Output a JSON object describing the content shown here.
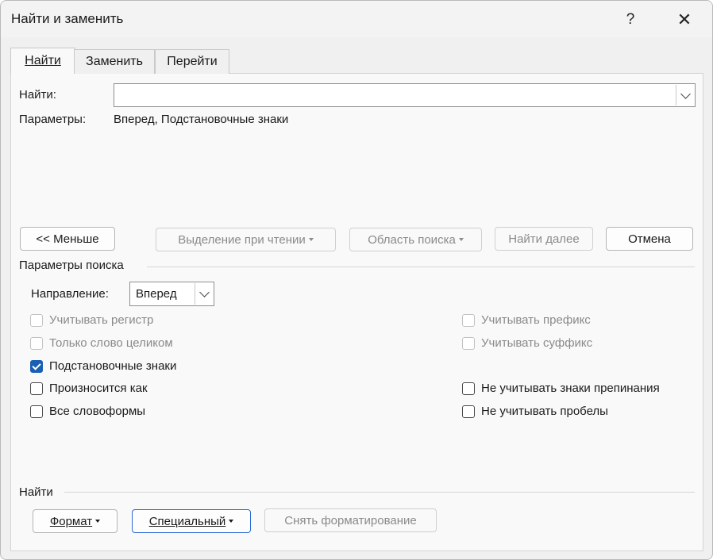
{
  "window": {
    "title": "Найти и заменить",
    "help_label": "?",
    "close_label": "✕"
  },
  "tabs": [
    {
      "label": "Найти",
      "active": true
    },
    {
      "label": "Заменить",
      "active": false
    },
    {
      "label": "Перейти",
      "active": false
    }
  ],
  "find": {
    "label": "Найти:",
    "value": "",
    "params_label": "Параметры:",
    "params_value": "Вперед, Подстановочные знаки"
  },
  "buttons": {
    "less": "<< Меньше",
    "reading_highlight": "Выделение при чтении",
    "find_in": "Область поиска",
    "find_next": "Найти далее",
    "cancel": "Отмена"
  },
  "search_options": {
    "title": "Параметры поиска",
    "direction_label": "Направление:",
    "direction_value": "Вперед",
    "left": [
      {
        "label": "Учитывать регистр",
        "checked": false,
        "enabled": false
      },
      {
        "label": "Только слово целиком",
        "checked": false,
        "enabled": false
      },
      {
        "label": "Подстановочные знаки",
        "checked": true,
        "enabled": true
      },
      {
        "label": "Произносится как",
        "checked": false,
        "enabled": true
      },
      {
        "label": "Все словоформы",
        "checked": false,
        "enabled": true
      }
    ],
    "right": [
      {
        "label": "Учитывать префикс",
        "checked": false,
        "enabled": false
      },
      {
        "label": "Учитывать суффикс",
        "checked": false,
        "enabled": false
      },
      {
        "label": "Не учитывать знаки препинания",
        "checked": false,
        "enabled": true
      },
      {
        "label": "Не учитывать пробелы",
        "checked": false,
        "enabled": true
      }
    ]
  },
  "find_section": {
    "title": "Найти",
    "format": "Формат",
    "special": "Специальный",
    "no_formatting": "Снять форматирование"
  }
}
